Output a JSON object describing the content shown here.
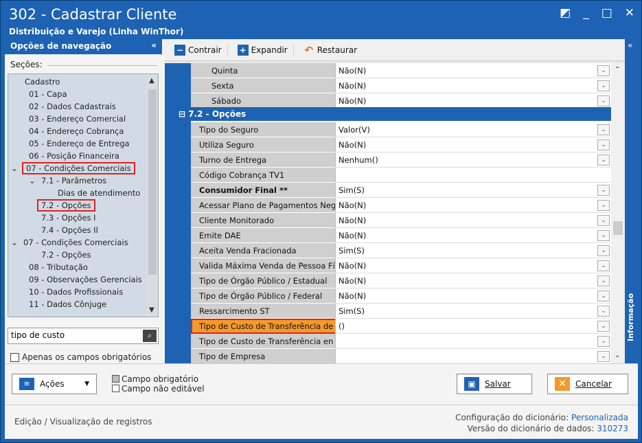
{
  "window": {
    "title": "302 - Cadastrar Cliente",
    "subtitle": "Distribuição e Varejo (Linha WinThor)",
    "controls": [
      "◩",
      "_",
      "□",
      "✕"
    ]
  },
  "nav": {
    "header": "Opções de navegação",
    "collapse": "«",
    "sections_label": "Seções:",
    "tree": [
      "Cadastro",
      "01 - Capa",
      "02 - Dados Cadastrais",
      "03 - Endereço Comercial",
      "04 - Endereço Cobrança",
      "05 - Endereço de Entrega",
      "06 - Posição Financeira",
      "07 - Condições Comerciais",
      "7.1 - Parâmetros",
      "Dias de atendimento",
      "7.2 - Opções",
      "7.3 - Opções I",
      "7.4 - Opções II",
      "07 - Condições Comerciais",
      "7.2 - Opções",
      "08 - Tributação",
      "09 - Observações Gerenciais",
      "10 - Dados Profissionais",
      "11 - Dados Cônjuge"
    ],
    "search_value": "tipo de custo",
    "only_required": "Apenas os campos obrigatórios"
  },
  "toolbar": {
    "collapse": "Contrair",
    "expand": "Expandir",
    "restore": "Restaurar",
    "info_collapse": "«"
  },
  "grid": {
    "top_rows": [
      {
        "label": "Quinta",
        "value": "Não(N)"
      },
      {
        "label": "Sexta",
        "value": "Não(N)"
      },
      {
        "label": "Sábado",
        "value": "Não(N)"
      }
    ],
    "group": "7.2 - Opções",
    "rows": [
      {
        "label": "Tipo do Seguro",
        "value": "Valor(V)"
      },
      {
        "label": "Utiliza Seguro",
        "value": "Não(N)"
      },
      {
        "label": "Turno de Entrega",
        "value": "Nenhum()"
      },
      {
        "label": "Código Cobrança TV1",
        "value": ""
      },
      {
        "label": "Consumidor Final **",
        "value": "Sim(S)"
      },
      {
        "label": "Acessar Plano de Pagamentos Neg",
        "value": "Não(N)"
      },
      {
        "label": "Cliente Monitorado",
        "value": "Não(N)"
      },
      {
        "label": "Emite DAE",
        "value": "Não(N)"
      },
      {
        "label": "Aceita Venda Fracionada",
        "value": "Sim(S)"
      },
      {
        "label": "Valida Máxima Venda de Pessoa Fís",
        "value": "Não(N)"
      },
      {
        "label": "Tipo de Órgão Público / Estadual",
        "value": "Não(N)"
      },
      {
        "label": "Tipo de Órgão Público / Federal",
        "value": "Não(N)"
      },
      {
        "label": "Ressarcimento ST",
        "value": "Sim(S)"
      },
      {
        "label": "Tipo de Custo de Transferência de",
        "value": "()"
      },
      {
        "label": "Tipo de Custo de Transferência en",
        "value": ""
      },
      {
        "label": "Tipo de Empresa",
        "value": ""
      }
    ]
  },
  "info_label": "Informação",
  "bottom": {
    "actions": "Ações",
    "legend_required": "Campo obrigatório",
    "legend_not_editable": "Campo não editável",
    "save": "Salvar",
    "cancel": "Cancelar"
  },
  "status": {
    "left": "Edição / Visualização de registros",
    "config_label": "Configuração do dicionário:",
    "config_value": "Personalizada",
    "version_label": "Versão do dicionário de dados:",
    "version_value": "310273"
  },
  "colors": {
    "accent": "#1d62b3",
    "highlight": "#e02020",
    "selected_row": "#f39a2b"
  }
}
